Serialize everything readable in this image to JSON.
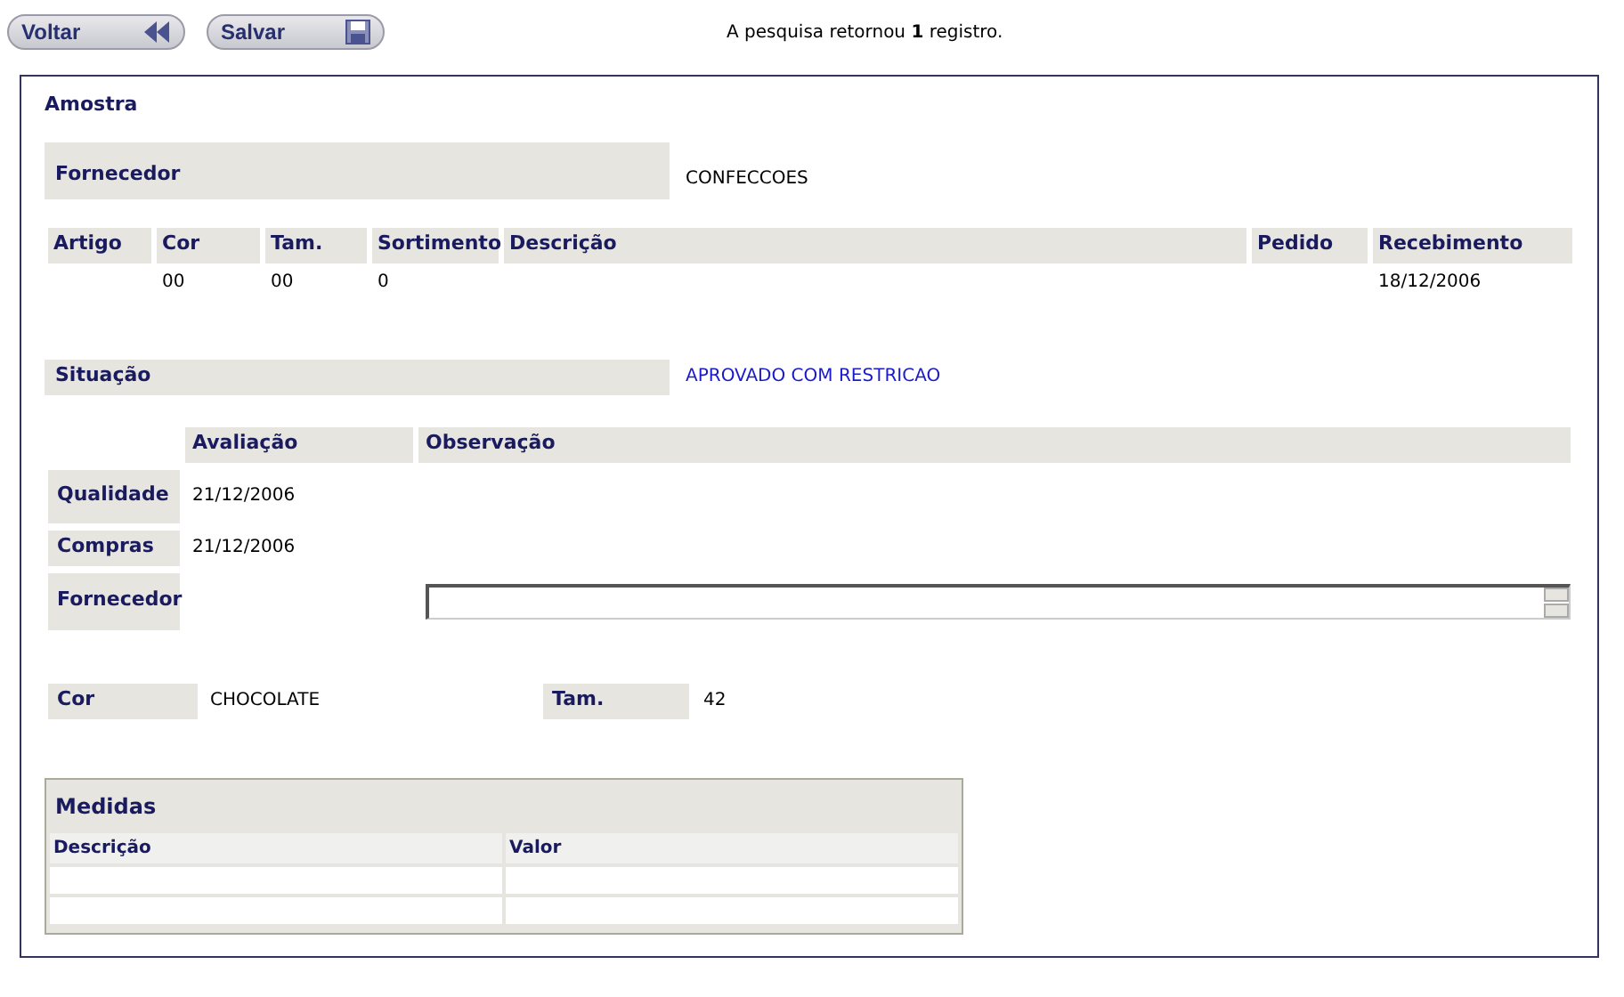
{
  "toolbar": {
    "buttons": [
      {
        "label": "Voltar",
        "kind": "back"
      },
      {
        "label": "Salvar",
        "kind": "save"
      }
    ],
    "message": "A pesquisa retornou **1** registro."
  },
  "panel": {
    "title": "Amostra",
    "fornecedor": {
      "label": "Fornecedor",
      "value": "CONFECCOES"
    },
    "items_table": {
      "columns": [
        "Artigo",
        "Cor",
        "Tam.",
        "Sortimento",
        "Descrição",
        "Pedido",
        "Recebimento"
      ],
      "rows": [
        {
          "cells": [
            "",
            "00",
            "00",
            "0",
            "",
            "",
            "18/12/2006"
          ]
        }
      ]
    },
    "situacao": {
      "label": "Situação",
      "value": "APROVADO COM RESTRICAO"
    },
    "avaliacao": {
      "columns": [
        "Avaliação",
        "Observação"
      ],
      "rows": [
        {
          "label": "Qualidade",
          "date": "21/12/2006",
          "kind": "text"
        },
        {
          "label": "Compras",
          "date": "21/12/2006",
          "kind": "text"
        },
        {
          "label": "Fornecedor",
          "date": "",
          "kind": "field"
        }
      ]
    },
    "cor": {
      "label": "Cor",
      "value": "CHOCOLATE"
    },
    "tam": {
      "label": "Tam.",
      "value": "42"
    },
    "medidas": {
      "title": "Medidas",
      "columns": [
        "Descrição",
        "Valor"
      ]
    }
  }
}
